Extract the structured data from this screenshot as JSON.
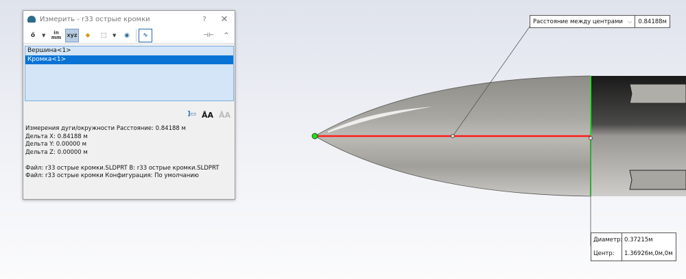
{
  "dialog": {
    "title": "Измерить - r33 острые кромки",
    "help": "?",
    "close": "✕",
    "toolbar": {
      "units": "in\nmm",
      "pin": "⊣⊢",
      "collapse": "^"
    },
    "selections": [
      "Вершина<1>",
      "Кромка<1>"
    ],
    "results": [
      "Измерения дуги/окружности Расстояние: 0.84188 м",
      "Дельта X: 0.84188 м",
      "Дельта Y: 0.00000 м",
      "Дельта Z: 0.00000 м",
      "",
      "Файл: r33 острые кромки.SLDPRT В: r33 острые кромки.SLDPRT",
      "Файл: r33 острые кромки Конфигурация: По умолчанию"
    ]
  },
  "callout_distance": {
    "mode": "Расстояние между центрами",
    "value": "0.84188м"
  },
  "callout_circle": {
    "diameter_label": "Диаметр:",
    "diameter_value": "0.37215м",
    "center_label": "Центр:",
    "center_value": "1.36926м,0м,0м"
  },
  "colors": {
    "selection": "#0a74d6",
    "measure_line": "#ff1a1a",
    "edge_highlight": "#22dd22"
  }
}
